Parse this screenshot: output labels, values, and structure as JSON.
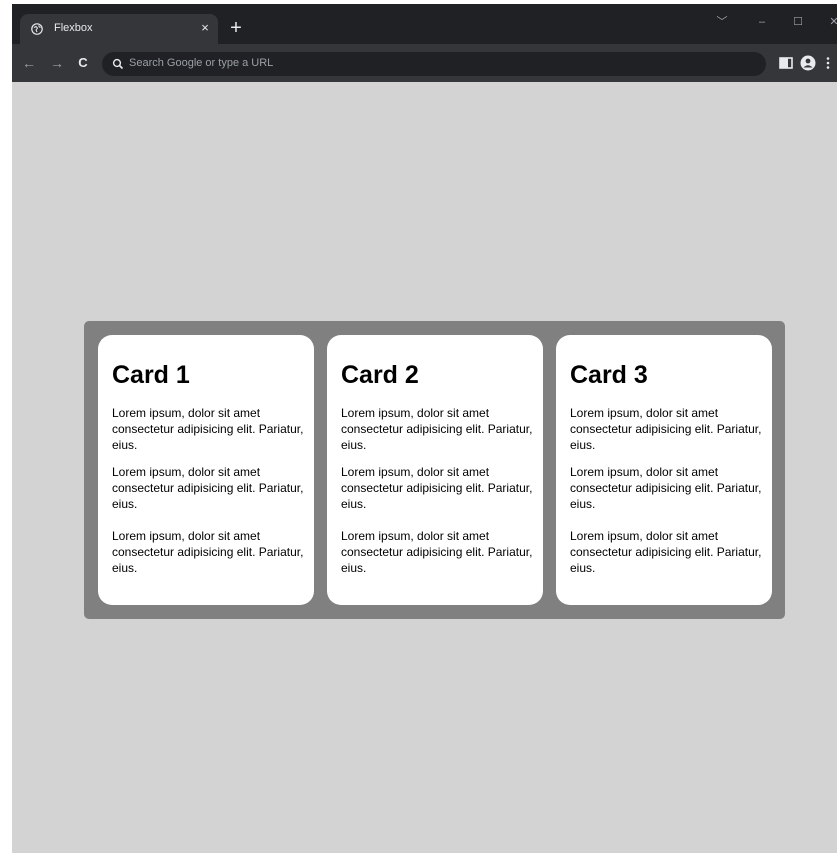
{
  "browser": {
    "tab": {
      "title": "Flexbox",
      "close_glyph": "×",
      "favicon": "globe-icon"
    },
    "new_tab_glyph": "+",
    "window_controls": [
      "﹀",
      "–",
      "☐",
      "✕"
    ],
    "nav": {
      "back": "←",
      "forward": "→",
      "reload": "C"
    },
    "omnibox": {
      "placeholder": "Search Google or type a URL"
    }
  },
  "page": {
    "background": "#d3d3d3",
    "container_color": "#808080",
    "cards": [
      {
        "title": "Card 1",
        "paragraphs": [
          "Lorem ipsum, dolor sit amet consectetur adipisicing elit. Pariatur, eius.",
          "Lorem ipsum, dolor sit amet consectetur adipisicing elit. Pariatur, eius.",
          "Lorem ipsum, dolor sit amet consectetur adipisicing elit. Pariatur, eius."
        ]
      },
      {
        "title": "Card 2",
        "paragraphs": [
          "Lorem ipsum, dolor sit amet consectetur adipisicing elit. Pariatur, eius.",
          "Lorem ipsum, dolor sit amet consectetur adipisicing elit. Pariatur, eius.",
          "Lorem ipsum, dolor sit amet consectetur adipisicing elit. Pariatur, eius."
        ]
      },
      {
        "title": "Card 3",
        "paragraphs": [
          "Lorem ipsum, dolor sit amet consectetur adipisicing elit. Pariatur, eius.",
          "Lorem ipsum, dolor sit amet consectetur adipisicing elit. Pariatur, eius.",
          "Lorem ipsum, dolor sit amet consectetur adipisicing elit. Pariatur, eius."
        ]
      }
    ]
  }
}
